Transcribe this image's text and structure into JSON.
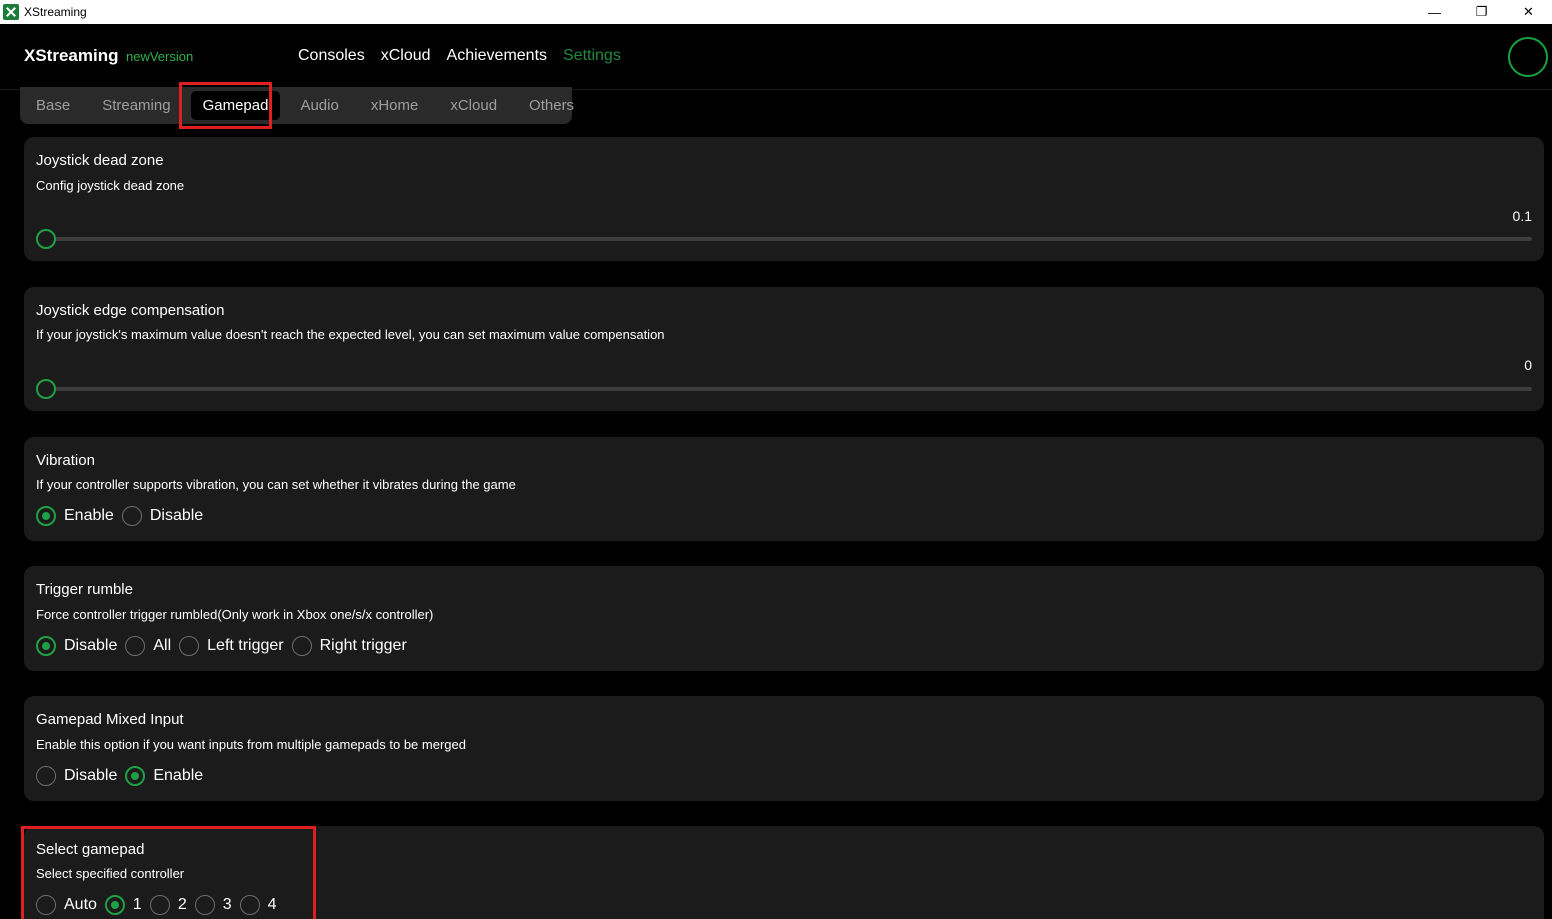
{
  "window": {
    "title": "XStreaming",
    "minimize": "—",
    "restore": "❐",
    "close": "✕"
  },
  "header": {
    "brand": "XStreaming",
    "new_version": "newVersion",
    "nav": [
      {
        "label": "Consoles",
        "active": false
      },
      {
        "label": "xCloud",
        "active": false
      },
      {
        "label": "Achievements",
        "active": false
      },
      {
        "label": "Settings",
        "active": true
      }
    ]
  },
  "tabs": [
    {
      "label": "Base",
      "active": false
    },
    {
      "label": "Streaming",
      "active": false
    },
    {
      "label": "Gamepad",
      "active": true
    },
    {
      "label": "Audio",
      "active": false
    },
    {
      "label": "xHome",
      "active": false
    },
    {
      "label": "xCloud",
      "active": false
    },
    {
      "label": "Others",
      "active": false
    }
  ],
  "settings": {
    "dead_zone": {
      "title": "Joystick dead zone",
      "description": "Config joystick dead zone",
      "value": "0.1",
      "fraction": 0.0
    },
    "edge_comp": {
      "title": "Joystick edge compensation",
      "description": "If your joystick's maximum value doesn't reach the expected level, you can set maximum value compensation",
      "value": "0",
      "fraction": 0.0
    },
    "vibration": {
      "title": "Vibration",
      "description": "If your controller supports vibration, you can set whether it vibrates during the game",
      "options": [
        "Enable",
        "Disable"
      ],
      "selected": "Enable"
    },
    "trigger_rumble": {
      "title": "Trigger rumble",
      "description": "Force controller trigger rumbled(Only work in Xbox one/s/x controller)",
      "options": [
        "Disable",
        "All",
        "Left trigger",
        "Right trigger"
      ],
      "selected": "Disable"
    },
    "mixed_input": {
      "title": "Gamepad Mixed Input",
      "description": "Enable this option if you want inputs from multiple gamepads to be merged",
      "options": [
        "Disable",
        "Enable"
      ],
      "selected": "Enable"
    },
    "select_gamepad": {
      "title": "Select gamepad",
      "description": "Select specified controller",
      "options": [
        "Auto",
        "1",
        "2",
        "3",
        "4"
      ],
      "selected": "1"
    }
  },
  "colors": {
    "accent": "#1fa044",
    "highlight": "#e02020",
    "card": "#1b1b1b"
  }
}
